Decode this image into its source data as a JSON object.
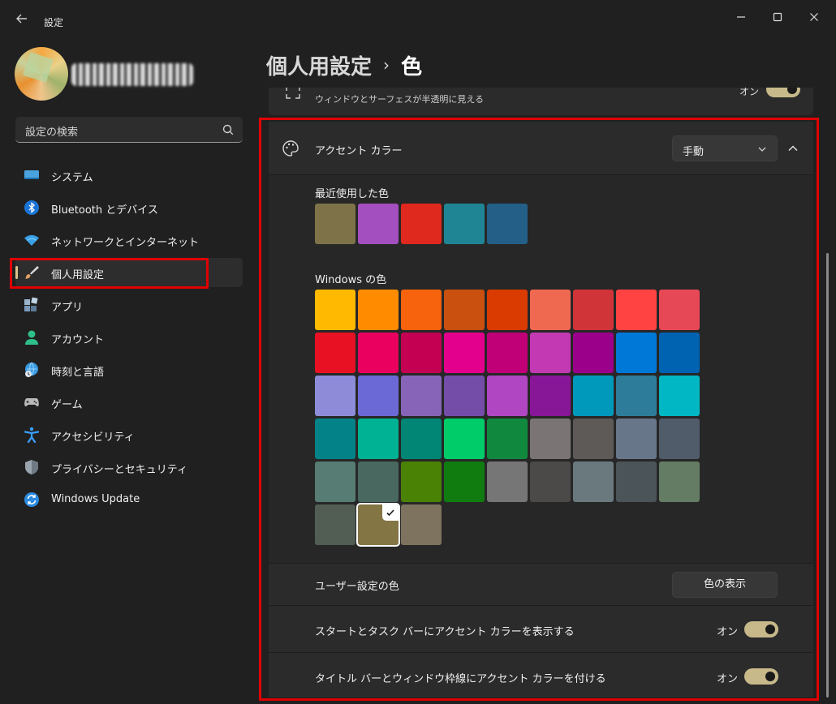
{
  "window": {
    "title": "設定",
    "back_icon": "back-arrow-icon",
    "controls": [
      "minimize-icon",
      "maximize-icon",
      "close-icon"
    ]
  },
  "sidebar": {
    "search": {
      "placeholder": "設定の検索",
      "icon": "search-icon"
    },
    "items": [
      {
        "label": "システム",
        "icon": "system-icon",
        "color": "#4aa3df"
      },
      {
        "label": "Bluetooth とデバイス",
        "icon": "bluetooth-icon",
        "color": "#1a74d6"
      },
      {
        "label": "ネットワークとインターネット",
        "icon": "wifi-icon",
        "color": "#3aa0e8"
      },
      {
        "label": "個人用設定",
        "icon": "brush-icon",
        "color": "#e0a060",
        "active": true
      },
      {
        "label": "アプリ",
        "icon": "apps-icon",
        "color": "#7a9ab8"
      },
      {
        "label": "アカウント",
        "icon": "account-icon",
        "color": "#2fbf8a"
      },
      {
        "label": "時刻と言語",
        "icon": "time-language-icon",
        "color": "#3a9be0"
      },
      {
        "label": "ゲーム",
        "icon": "gamepad-icon",
        "color": "#b8b8b8"
      },
      {
        "label": "アクセシビリティ",
        "icon": "accessibility-icon",
        "color": "#3aa0ff"
      },
      {
        "label": "プライバシーとセキュリティ",
        "icon": "shield-icon",
        "color": "#9aa4ae"
      },
      {
        "label": "Windows Update",
        "icon": "update-icon",
        "color": "#2a8be0"
      }
    ]
  },
  "breadcrumb": {
    "parent": "個人用設定",
    "separator": "›",
    "current": "色"
  },
  "transparency": {
    "subtitle": "ウィンドウとサーフェスが半透明に見える",
    "state": "オン"
  },
  "accent": {
    "title": "アクセント カラー",
    "mode_value": "手動",
    "recent_label": "最近使用した色",
    "recent_colors": [
      "#7e7348",
      "#a34fbf",
      "#e0291e",
      "#1f8594",
      "#235f87"
    ],
    "windows_label": "Windows の色",
    "windows_colors": [
      [
        "#ffb900",
        "#ff8c00",
        "#f7630c",
        "#ca5010",
        "#da3b01",
        "#ef6950",
        "#d13438",
        "#ff4343",
        "#e74856"
      ],
      [
        "#e81123",
        "#ea005e",
        "#c30052",
        "#e3008c",
        "#bf0077",
        "#c239b3",
        "#9a0089",
        "#0078d7",
        "#0063b1"
      ],
      [
        "#8e8cd8",
        "#6b69d6",
        "#8764b8",
        "#744da9",
        "#b146c2",
        "#881798",
        "#0099bc",
        "#2d7d9a",
        "#00b7c3"
      ],
      [
        "#038387",
        "#00b294",
        "#018574",
        "#00cc6a",
        "#10893e",
        "#7a7574",
        "#5d5a58",
        "#68768a",
        "#515c6b"
      ],
      [
        "#567c73",
        "#486860",
        "#498205",
        "#107c10",
        "#767676",
        "#4c4a48",
        "#69797e",
        "#4a5459",
        "#647c64"
      ],
      [
        "#525e54",
        "#847545",
        "#7e735f"
      ]
    ],
    "selected_color": "#847545",
    "custom_label": "ユーザー設定の色",
    "view_button": "色の表示",
    "start_taskbar_label": "スタートとタスク バーにアクセント カラーを表示する",
    "start_taskbar_state": "オン",
    "titlebar_label": "タイトル バーとウィンドウ枠線にアクセント カラーを付ける",
    "titlebar_state": "オン"
  },
  "colors": {
    "highlight": "#e00000",
    "toggle_on": "#c7b98a"
  }
}
